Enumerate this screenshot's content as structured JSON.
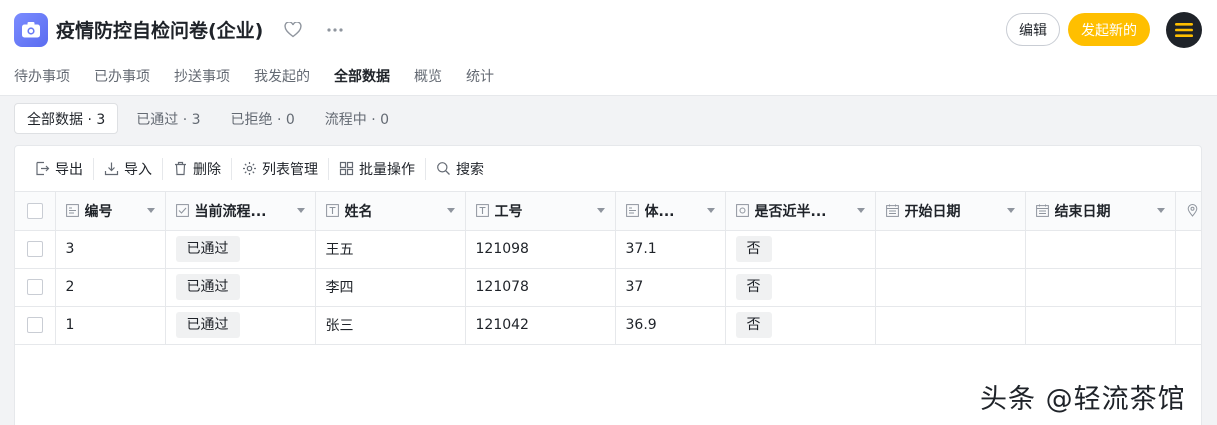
{
  "app": {
    "title": "疫情防控自检问卷(企业)",
    "accent": "#ffbf00",
    "icon_color": "#6a7bf6"
  },
  "header": {
    "edit_label": "编辑",
    "new_label": "发起新的",
    "favorite_icon": "heart-icon",
    "more_icon": "more-icon"
  },
  "tabs": [
    {
      "label": "待办事项"
    },
    {
      "label": "已办事项"
    },
    {
      "label": "抄送事项"
    },
    {
      "label": "我发起的"
    },
    {
      "label": "全部数据",
      "active": true
    },
    {
      "label": "概览"
    },
    {
      "label": "统计"
    }
  ],
  "filters": [
    {
      "label": "全部数据 · 3",
      "active": true
    },
    {
      "label": "已通过 · 3"
    },
    {
      "label": "已拒绝 · 0"
    },
    {
      "label": "流程中 · 0"
    }
  ],
  "toolbar": [
    {
      "label": "导出",
      "icon": "export-icon"
    },
    {
      "label": "导入",
      "icon": "import-icon"
    },
    {
      "label": "删除",
      "icon": "trash-icon"
    },
    {
      "label": "列表管理",
      "icon": "gear-icon"
    },
    {
      "label": "批量操作",
      "icon": "batch-icon"
    },
    {
      "label": "搜索",
      "icon": "search-icon"
    }
  ],
  "table": {
    "columns": [
      {
        "label": "编号",
        "icon": "number-field-icon"
      },
      {
        "label": "当前流程...",
        "icon": "checkbox-field-icon"
      },
      {
        "label": "姓名",
        "icon": "text-field-icon"
      },
      {
        "label": "工号",
        "icon": "text-field-icon"
      },
      {
        "label": "体...",
        "icon": "number-field-icon"
      },
      {
        "label": "是否近半...",
        "icon": "radio-field-icon"
      },
      {
        "label": "开始日期",
        "icon": "calendar-icon"
      },
      {
        "label": "结束日期",
        "icon": "calendar-icon"
      },
      {
        "label": "",
        "icon": "location-icon"
      }
    ],
    "rows": [
      {
        "id": "3",
        "status": "已通过",
        "name": "王五",
        "emp_no": "121098",
        "temp": "37.1",
        "recent": "否",
        "start": "",
        "end": ""
      },
      {
        "id": "2",
        "status": "已通过",
        "name": "李四",
        "emp_no": "121078",
        "temp": "37",
        "recent": "否",
        "start": "",
        "end": ""
      },
      {
        "id": "1",
        "status": "已通过",
        "name": "张三",
        "emp_no": "121042",
        "temp": "36.9",
        "recent": "否",
        "start": "",
        "end": ""
      }
    ]
  },
  "watermark": "头条 @轻流茶馆"
}
